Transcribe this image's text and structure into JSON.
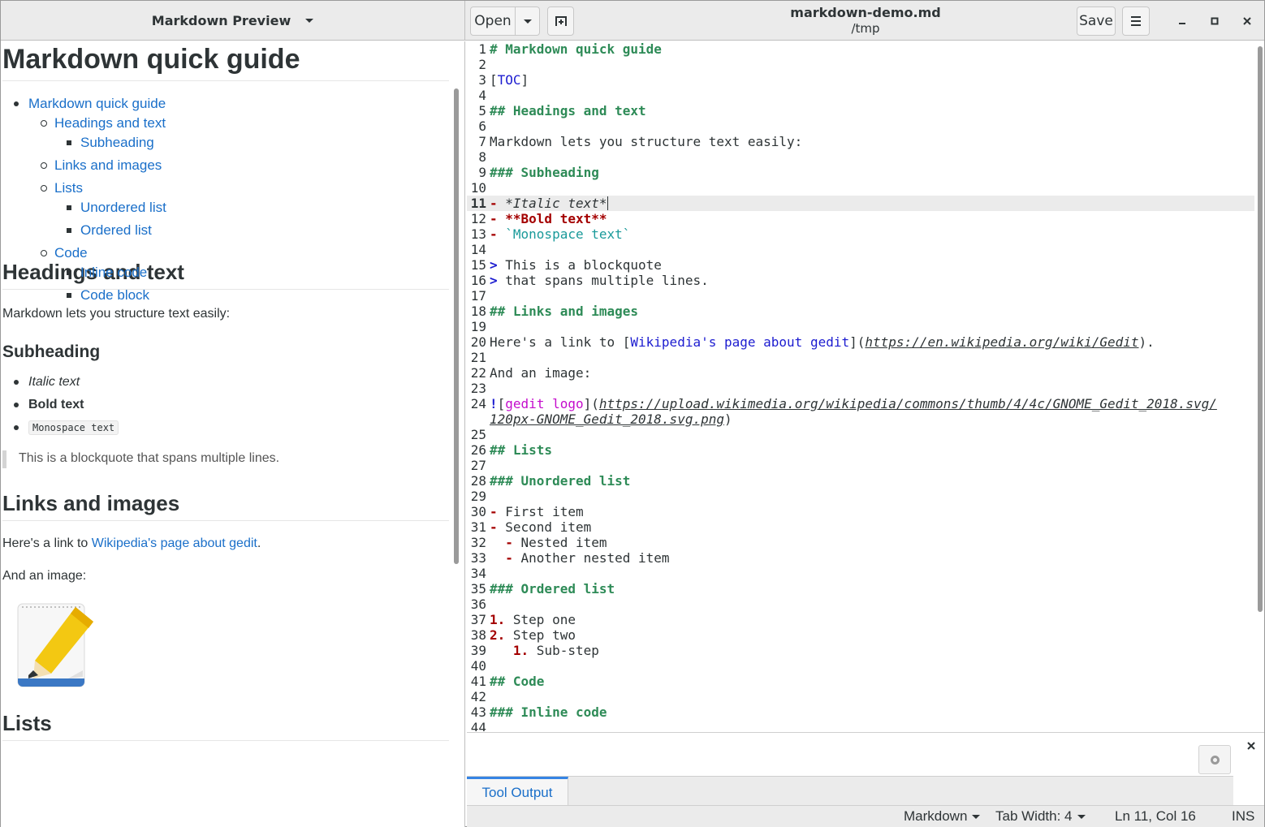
{
  "side_panel": {
    "title": "Markdown Preview",
    "doc_title": "Markdown quick guide",
    "toc": {
      "guide": "Markdown quick guide",
      "headings": "Headings and text",
      "subheading": "Subheading",
      "links": "Links and images",
      "lists": "Lists",
      "unordered": "Unordered list",
      "ordered": "Ordered list",
      "code": "Code",
      "inline": "Inline code",
      "block": "Code block"
    },
    "h_headings": "Headings and text",
    "p_structure": "Markdown lets you structure text easily:",
    "h_sub": "Subheading",
    "italic": "Italic text",
    "bold": "Bold text",
    "mono": "Monospace text",
    "quote": "This is a blockquote that spans multiple lines.",
    "h_links": "Links and images",
    "p_link_pre": "Here's a link to ",
    "p_link_text": "Wikipedia's page about gedit",
    "p_link_post": ".",
    "p_image": "And an image:",
    "h_lists": "Lists"
  },
  "header": {
    "open_label": "Open",
    "file_name": "markdown-demo.md",
    "file_path": "/tmp",
    "save_label": "Save"
  },
  "editor": {
    "current_line": 11,
    "line_numbers": [
      "1",
      "2",
      "3",
      "4",
      "5",
      "6",
      "7",
      "8",
      "9",
      "10",
      "11",
      "12",
      "13",
      "14",
      "15",
      "16",
      "17",
      "18",
      "19",
      "20",
      "21",
      "22",
      "23",
      "24",
      "",
      "25",
      "26",
      "27",
      "28",
      "29",
      "30",
      "31",
      "32",
      "33",
      "34",
      "35",
      "36",
      "37",
      "38",
      "39",
      "40",
      "41",
      "42",
      "43",
      "44"
    ],
    "lines": {
      "l1": "# Markdown quick guide",
      "l3a": "[",
      "l3b": "TOC",
      "l3c": "]",
      "l5": "## Headings and text",
      "l7": "Markdown lets you structure text easily:",
      "l9": "### Subheading",
      "l11a": "- ",
      "l11b": "*Italic text*",
      "l12a": "- ",
      "l12b": "**Bold text**",
      "l13a": "- ",
      "l13b": "`Monospace text`",
      "l15a": "> ",
      "l15b": "This is a blockquote",
      "l16a": "> ",
      "l16b": "that spans multiple lines.",
      "l18": "## Links and images",
      "l20a": "Here's a link to [",
      "l20b": "Wikipedia's page about gedit",
      "l20c": "](",
      "l20d": "https://en.wikipedia.org/wiki/Gedit",
      "l20e": ").",
      "l22": "And an image:",
      "l24a": "!",
      "l24b": "[",
      "l24c": "gedit logo",
      "l24d": "](",
      "l24e": "https://upload.wikimedia.org/wikipedia/commons/thumb/4/4c/GNOME_Gedit_2018.svg/",
      "l24f": "120px-GNOME_Gedit_2018.svg.png",
      "l24g": ")",
      "l26": "## Lists",
      "l28": "### Unordered list",
      "l30a": "- ",
      "l30b": "First item",
      "l31a": "- ",
      "l31b": "Second item",
      "l32a": "  - ",
      "l32b": "Nested item",
      "l33a": "  - ",
      "l33b": "Another nested item",
      "l35": "### Ordered list",
      "l37a": "1.",
      "l37b": " Step one",
      "l38a": "2.",
      "l38b": " Step two",
      "l39a": "   1.",
      "l39b": " Sub-step",
      "l41": "## Code",
      "l43": "### Inline code"
    }
  },
  "bottom_panel": {
    "tab_label": "Tool Output"
  },
  "status_bar": {
    "language": "Markdown",
    "tab_width": "Tab Width: 4",
    "position": "Ln 11, Col 16",
    "mode": "INS"
  }
}
